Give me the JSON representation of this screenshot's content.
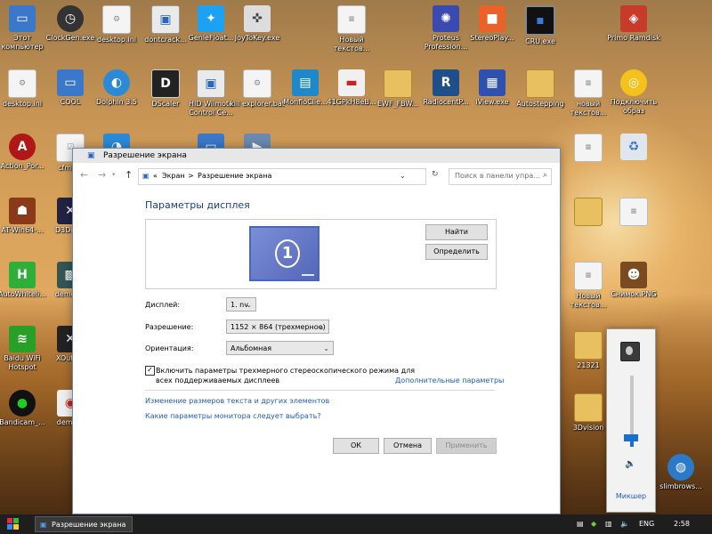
{
  "desktop": {
    "icons": [
      {
        "label": "Этот компьютер"
      },
      {
        "label": "ClockGen.exe"
      },
      {
        "label": "desktop.ini"
      },
      {
        "label": "dontcrack..."
      },
      {
        "label": "GenieFloat..."
      },
      {
        "label": "JoyToKey.exe"
      },
      {
        "label": "Новый текстов..."
      },
      {
        "label": "Proteus Profession..."
      },
      {
        "label": "StereoPlay..."
      },
      {
        "label": "CRU.exe"
      },
      {
        "label": "Primo Ramdisk"
      },
      {
        "label": "desktop.ini"
      },
      {
        "label": "COOL"
      },
      {
        "label": "Dolphin 3.5"
      },
      {
        "label": "DScaler"
      },
      {
        "label": "HID Wiimote Control Ce..."
      },
      {
        "label": "kill explorer.bat"
      },
      {
        "label": "MonfloClie..."
      },
      {
        "label": "41GPkH8eB..."
      },
      {
        "label": "EWF_FBW..."
      },
      {
        "label": "RadiocentP..."
      },
      {
        "label": "iView.exe"
      },
      {
        "label": "Autostepping"
      },
      {
        "label": "новый текстов..."
      },
      {
        "label": "Подключить образ"
      },
      {
        "label": "Action_Por..."
      },
      {
        "label": "cfmn..."
      },
      {
        "label": "AT-Win64-..."
      },
      {
        "label": "D3Dov..."
      },
      {
        "label": "AutoWhiteli..."
      },
      {
        "label": "demo_..."
      },
      {
        "label": "Baidu WiFi Hotspot"
      },
      {
        "label": "XOutp..."
      },
      {
        "label": "Bandicam_..."
      },
      {
        "label": "demu..."
      },
      {
        "label": "Новый текстов..."
      },
      {
        "label": "Снимок.PNG"
      },
      {
        "label": "21321"
      },
      {
        "label": "3Dvision"
      },
      {
        "label": "slimbrows..."
      }
    ]
  },
  "window": {
    "title": "Разрешение экрана",
    "address": {
      "crumb1": "Экран",
      "sep": ">",
      "crumb2": "Разрешение экрана",
      "prefix": "«"
    },
    "search_placeholder": "Поиск в панели упра...",
    "heading": "Параметры дисплея",
    "find_button": "Найти",
    "identify_button": "Определить",
    "monitor_number": "1",
    "display_label": "Дисплей:",
    "display_value": "1. nv",
    "resolution_label": "Разрешение:",
    "resolution_value": "1152 × 864 (трехмерное)",
    "orientation_label": "Ориентация:",
    "orientation_value": "Альбомная",
    "stereo_checkbox_line1": "Включить параметры трехмерного стереоскопического режима для",
    "stereo_checkbox_line2": "всех поддерживаемых дисплеев",
    "stereo_checked": true,
    "advanced_link": "Дополнительные параметры",
    "text_size_link": "Изменение размеров текста и других элементов",
    "which_settings_link": "Какие параметры монитора следует выбрать?",
    "ok_button": "ОК",
    "cancel_button": "Отмена",
    "apply_button": "Применить"
  },
  "volume_popup": {
    "mixer_label": "Микшер",
    "level": 0.12
  },
  "taskbar": {
    "task_label": "Разрешение экрана",
    "language": "ENG",
    "time": "2:58"
  },
  "colors": {
    "heading": "#1e3e80",
    "link": "#1e5fb8",
    "accent": "#1b6fcc",
    "taskbar": "#1e1e1e"
  }
}
